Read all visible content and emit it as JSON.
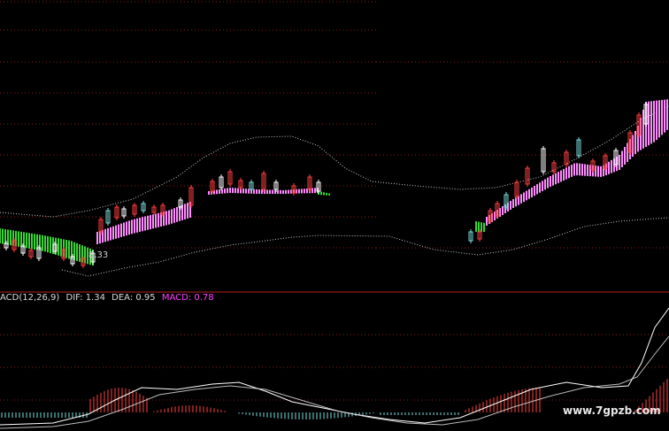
{
  "macd_header": {
    "name": "ACD(12,26,9)",
    "dif": "DIF: 1.34",
    "dea": "DEA: 0.95",
    "macd": "MACD: 0.78"
  },
  "price_label": "8.33",
  "watermark": "www.7gpzb.com",
  "colors": {
    "background": "#000000",
    "grid": "#8a1a1a",
    "divider": "#b51f1f",
    "band_pink": "#ff8cff",
    "band_green": "#35d635",
    "envelope": "#c8c8c8",
    "dif_line": "#ffffff",
    "dea_line": "#dcdcdc",
    "hist_up": "#ff4040",
    "hist_down": "#7adcdc",
    "label_text": "#d8d8d8",
    "macd_text": "#ff40ff"
  }
}
